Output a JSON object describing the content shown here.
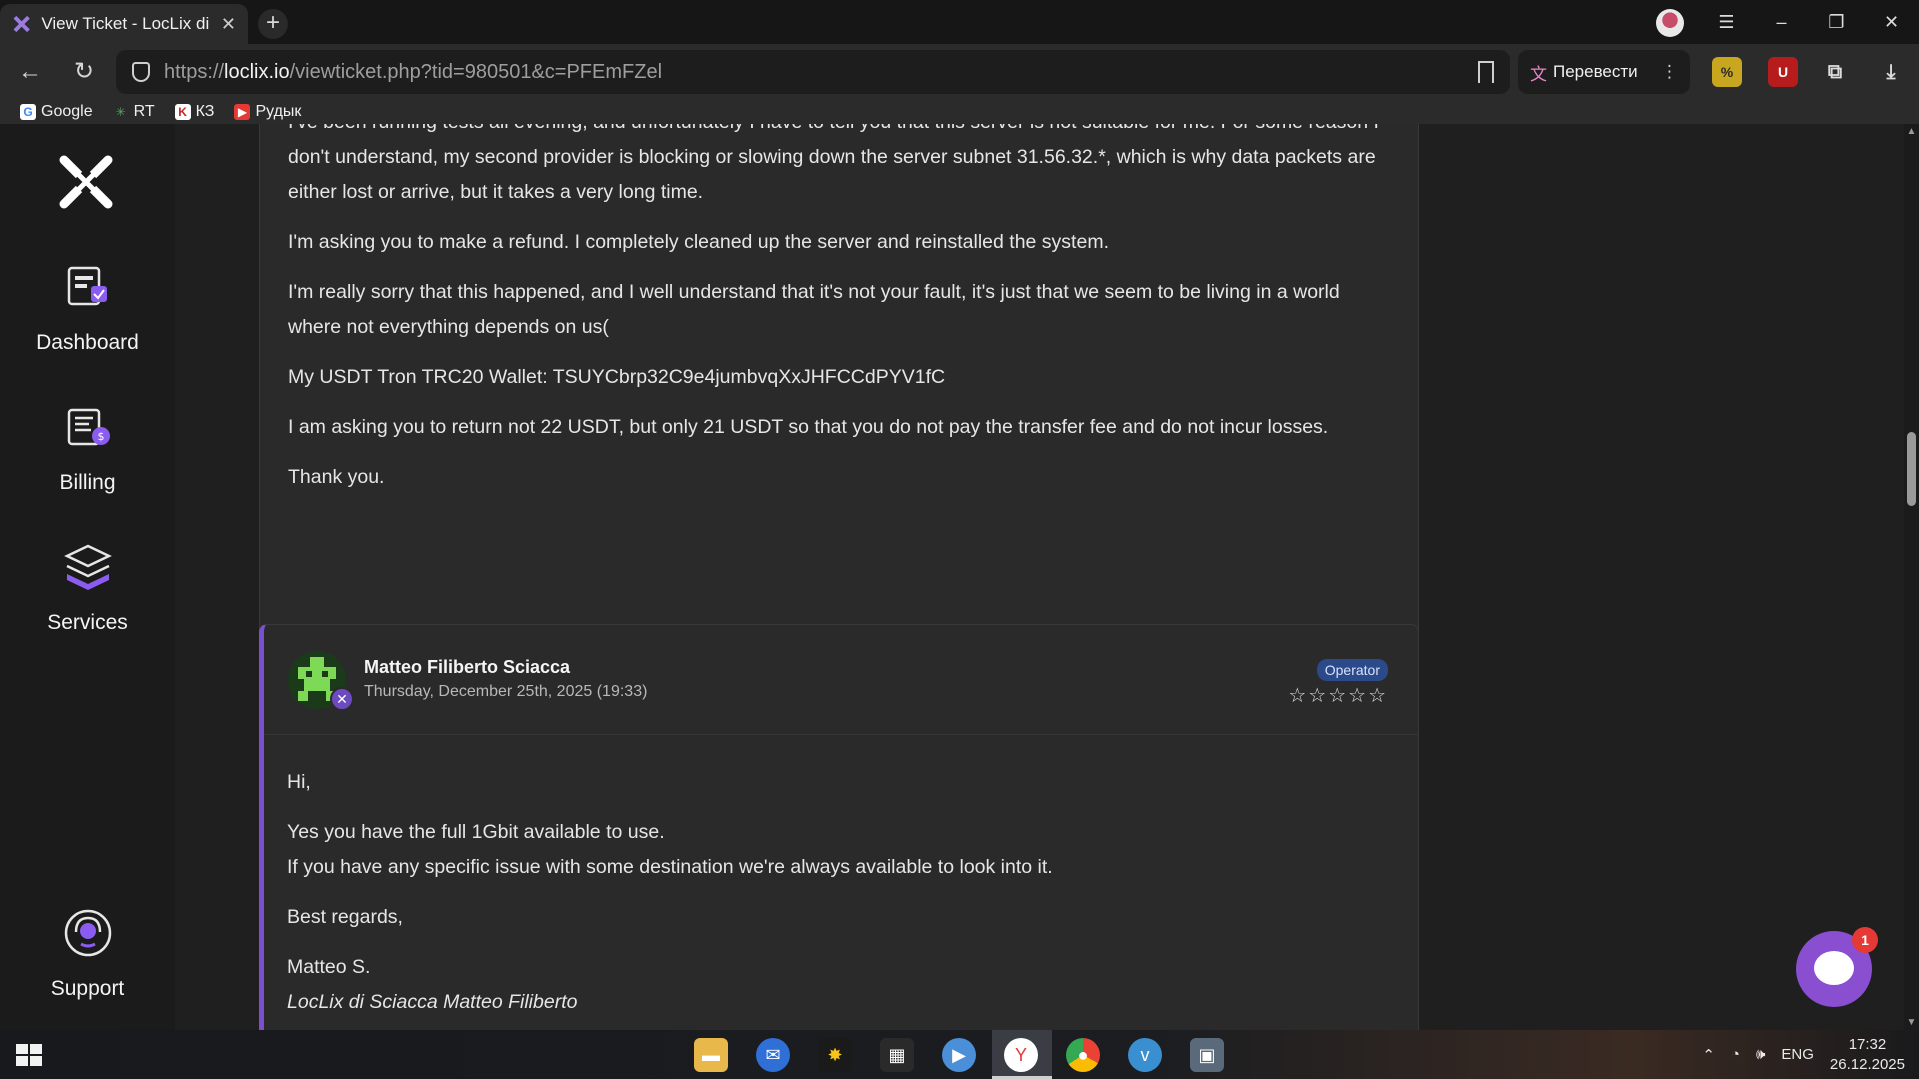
{
  "browser": {
    "tab_title": "View Ticket - LocLix di S",
    "url_prefix": "https://",
    "url_domain": "loclix.io",
    "url_path": "/viewticket.php?tid=980501&c=PFEmFZel",
    "translate_label": "Перевести",
    "bookmarks": [
      {
        "label": "Google",
        "icon": "google-icon",
        "color": "#4285f4"
      },
      {
        "label": "RT",
        "icon": "rt-icon",
        "color": "#4caf50"
      },
      {
        "label": "КЗ",
        "icon": "kz-icon",
        "color": "#c62828"
      },
      {
        "label": "Рудык",
        "icon": "youtube-icon",
        "color": "#e53935"
      }
    ]
  },
  "sidebar": {
    "items": [
      {
        "label": "Dashboard",
        "icon": "dashboard-icon"
      },
      {
        "label": "Billing",
        "icon": "billing-icon"
      },
      {
        "label": "Services",
        "icon": "services-icon"
      },
      {
        "label": "Support",
        "icon": "support-icon"
      }
    ]
  },
  "ticket": {
    "client_message": {
      "paragraphs": [
        "I've been running tests all evening, and unfortunately I have to tell you that this server is not suitable for me. For some reason I don't understand, my second provider is blocking or slowing down the server subnet 31.56.32.*, which is why data packets are either lost or arrive, but it takes a very long time.",
        "I'm asking you to make a refund. I completely cleaned up the server and reinstalled the system.",
        "I'm really sorry that this happened, and I well understand that it's not your fault, it's just that we seem to be living in a world where not everything depends on us(",
        "My USDT Tron TRC20 Wallet: TSUYCbrp32C9e4jumbvqXxJHFCCdPYV1fC",
        "I am asking you to return not 22 USDT, but only 21 USDT so that you do not pay the transfer fee and do not incur losses.",
        "Thank you."
      ]
    },
    "reply": {
      "author": "Matteo Filiberto Sciacca",
      "date": "Thursday, December 25th, 2025 (19:33)",
      "role": "Operator",
      "rating_stars": "☆☆☆☆☆",
      "greeting": "Hi,",
      "line1": "Yes you have the full 1Gbit available to use.",
      "line2": "If you have any specific issue with some destination we're always available to look into it.",
      "closing": "Best regards,",
      "signature_name": "Matteo S.",
      "signature_company": "LocLix di Sciacca Matteo Filiberto"
    }
  },
  "chat": {
    "unread": "1"
  },
  "taskbar": {
    "language": "ENG",
    "time": "17:32",
    "date": "26.12.2025"
  },
  "colors": {
    "accent": "#7a4fd0",
    "operator_badge": "#2c4a8a"
  }
}
